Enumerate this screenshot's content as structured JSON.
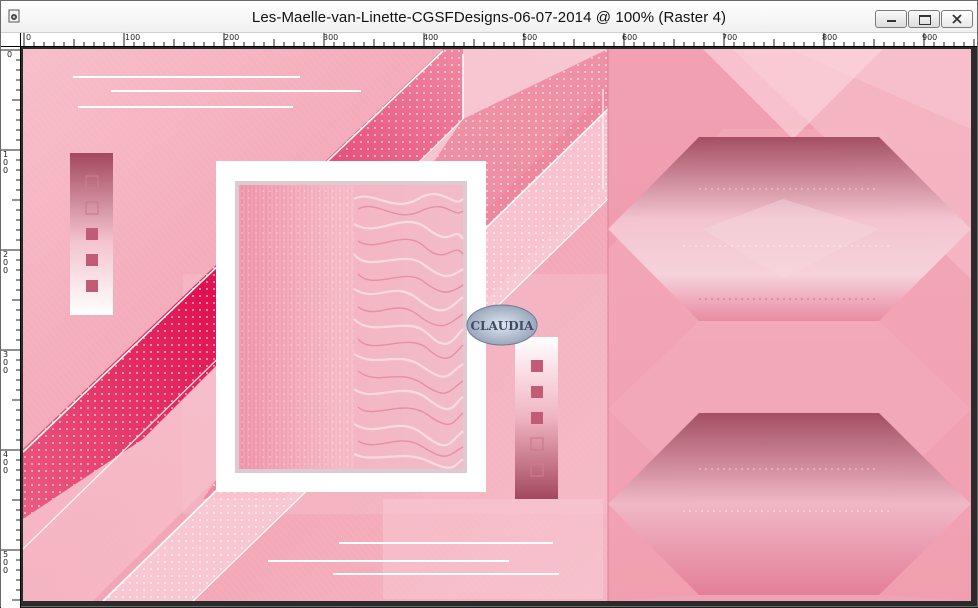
{
  "window": {
    "title": "Les-Maelle-van-Linette-CGSFDesigns-06-07-2014 @ 100% (Raster 4)",
    "controls": [
      "minimize",
      "maximize",
      "close"
    ]
  },
  "ruler": {
    "horizontal_labels": [
      "0",
      "100",
      "200",
      "300",
      "400",
      "500",
      "600",
      "700",
      "800",
      "900"
    ],
    "vertical_labels": [
      "0",
      "100",
      "200",
      "300",
      "400",
      "500"
    ]
  },
  "canvas": {
    "watermark_text": "CLAUDIA",
    "colors": {
      "pink_light": "#f7c3cd",
      "pink_mid": "#ee8aa0",
      "pink_deep": "#e0104f",
      "mauve": "#a14a5f",
      "white": "#ffffff"
    }
  }
}
